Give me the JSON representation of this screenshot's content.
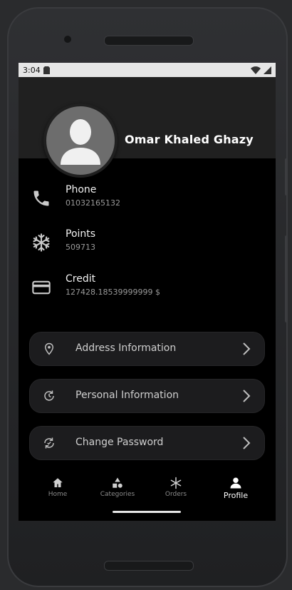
{
  "status_bar": {
    "time": "3:04"
  },
  "profile": {
    "name": "Omar Khaled Ghazy"
  },
  "info": [
    {
      "label": "Phone",
      "value": "01032165132",
      "icon": "phone-icon"
    },
    {
      "label": "Points",
      "value": "509713",
      "icon": "snowflake-icon"
    },
    {
      "label": "Credit",
      "value": "127428.18539999999 $",
      "icon": "credit-card-icon"
    }
  ],
  "menu": [
    {
      "label": "Address Information",
      "icon": "location-pin-icon"
    },
    {
      "label": "Personal Information",
      "icon": "history-icon"
    },
    {
      "label": "Change Password",
      "icon": "refresh-icon"
    }
  ],
  "nav": [
    {
      "label": "Home",
      "icon": "home-icon"
    },
    {
      "label": "Categories",
      "icon": "categories-icon"
    },
    {
      "label": "Orders",
      "icon": "snowflake-icon"
    },
    {
      "label": "Profile",
      "icon": "person-icon"
    }
  ],
  "colors": {
    "background": "#000000",
    "header": "#202020",
    "card": "#1c1c1e",
    "active": "#ffffff"
  }
}
